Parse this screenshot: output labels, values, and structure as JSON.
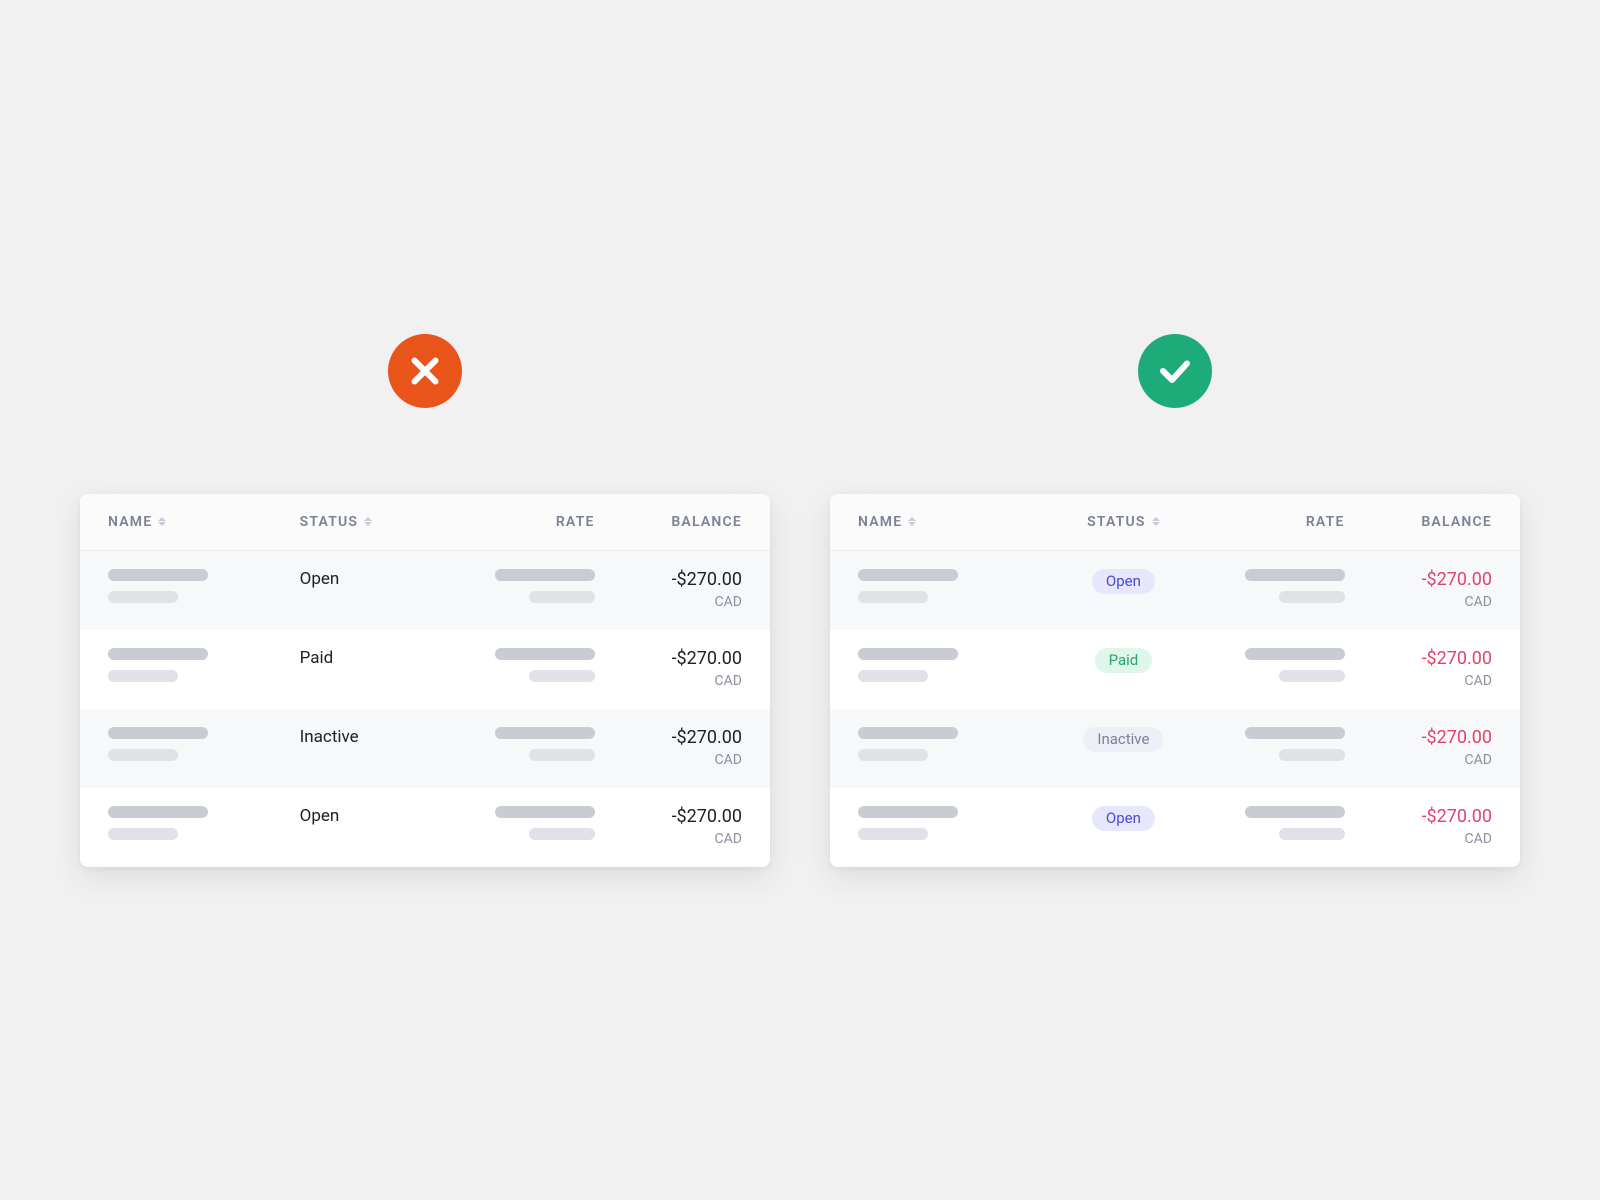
{
  "columns": {
    "name": "NAME",
    "status": "STATUS",
    "rate": "RATE",
    "balance": "BALANCE"
  },
  "rows": [
    {
      "status": "Open",
      "status_kind": "open",
      "amount": "-$270.00",
      "currency": "CAD"
    },
    {
      "status": "Paid",
      "status_kind": "paid",
      "amount": "-$270.00",
      "currency": "CAD"
    },
    {
      "status": "Inactive",
      "status_kind": "inactive",
      "amount": "-$270.00",
      "currency": "CAD"
    },
    {
      "status": "Open",
      "status_kind": "open",
      "amount": "-$270.00",
      "currency": "CAD"
    }
  ],
  "colors": {
    "bad_indicator": "#e8541a",
    "good_indicator": "#1eab7a",
    "negative_amount": "#e1436b"
  }
}
